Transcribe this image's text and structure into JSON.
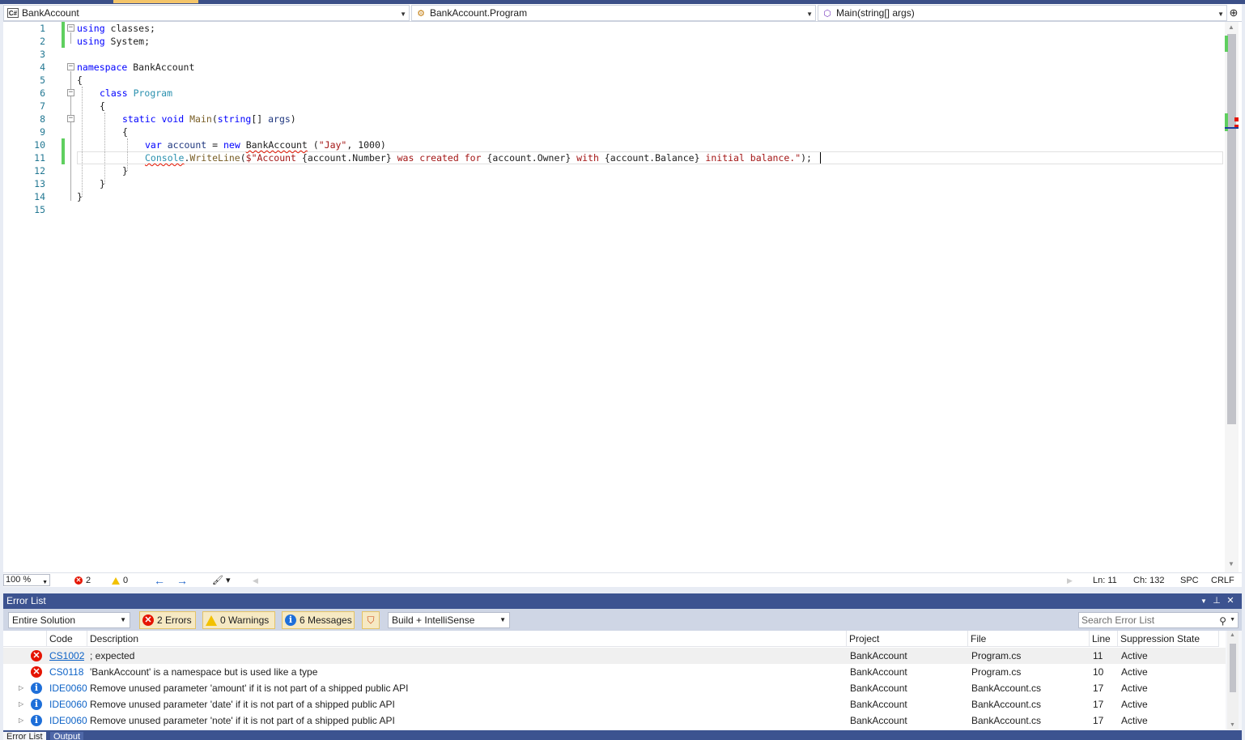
{
  "nav": {
    "project": "BankAccount",
    "project_icon": "C#",
    "type": "BankAccount.Program",
    "member": "Main(string[] args)"
  },
  "editor": {
    "line_numbers": [
      "1",
      "2",
      "3",
      "4",
      "5",
      "6",
      "7",
      "8",
      "9",
      "10",
      "11",
      "12",
      "13",
      "14",
      "15"
    ],
    "code": {
      "l1_kw": "using",
      "l1_rest": " classes;",
      "l2_kw": "using",
      "l2_rest": " System;",
      "l4_kw": "namespace",
      "l4_rest": " BankAccount",
      "l5": "{",
      "l6_kw": "class",
      "l6_ty": "Program",
      "l7": "{",
      "l8_kw1": "static",
      "l8_kw2": "void",
      "l8_me": "Main",
      "l8_p1": "(",
      "l8_kw3": "string",
      "l8_p2": "[] ",
      "l8_pa": "args",
      "l8_p3": ")",
      "l9": "{",
      "l10_kw1": "var",
      "l10_pa": "account",
      "l10_eq": " = ",
      "l10_kw2": "new",
      "l10_ty": "BankAccount",
      "l10_p1": " (",
      "l10_st": "\"Jay\"",
      "l10_p2": ", 1000)",
      "l11_ty": "Console",
      "l11_dot": ".",
      "l11_me": "WriteLine",
      "l11_p1": "(",
      "l11_s1": "$\"Account ",
      "l11_i1": "{account.Number}",
      "l11_s2": " was created for ",
      "l11_i2": "{account.Owner}",
      "l11_s3": " with ",
      "l11_i3": "{account.Balance}",
      "l11_s4": " initial balance.\"",
      "l11_p2": ");",
      "l12": "}",
      "l13": "}",
      "l14": "}"
    }
  },
  "status": {
    "zoom": "100 %",
    "errors": "2",
    "warnings": "0",
    "ln": "Ln: 11",
    "ch": "Ch: 132",
    "spc": "SPC",
    "crlf": "CRLF"
  },
  "error_list": {
    "title": "Error List",
    "scope": "Entire Solution",
    "errors_btn": "2 Errors",
    "warnings_btn": "0 Warnings",
    "messages_btn": "6 Messages",
    "build_filter": "Build + IntelliSense",
    "search_placeholder": "Search Error List",
    "columns": {
      "code": "Code",
      "description": "Description",
      "project": "Project",
      "file": "File",
      "line": "Line",
      "suppression": "Suppression State"
    },
    "rows": [
      {
        "code": "CS1002",
        "description": "; expected",
        "project": "BankAccount",
        "file": "Program.cs",
        "line": "11",
        "state": "Active"
      },
      {
        "code": "CS0118",
        "description": "'BankAccount' is a namespace but is used like a type",
        "project": "BankAccount",
        "file": "Program.cs",
        "line": "10",
        "state": "Active"
      },
      {
        "code": "IDE0060",
        "description": "Remove unused parameter 'amount' if it is not part of a shipped public API",
        "project": "BankAccount",
        "file": "BankAccount.cs",
        "line": "17",
        "state": "Active"
      },
      {
        "code": "IDE0060",
        "description": "Remove unused parameter 'date' if it is not part of a shipped public API",
        "project": "BankAccount",
        "file": "BankAccount.cs",
        "line": "17",
        "state": "Active"
      },
      {
        "code": "IDE0060",
        "description": "Remove unused parameter 'note' if it is not part of a shipped public API",
        "project": "BankAccount",
        "file": "BankAccount.cs",
        "line": "17",
        "state": "Active"
      }
    ],
    "tabs": {
      "errors": "Error List",
      "output": "Output"
    }
  },
  "colors": {
    "keyword": "#0000ff",
    "type": "#2b91af",
    "string": "#a31515",
    "error": "#e51400",
    "info": "#1e6fd9",
    "titlebar": "#3c5390"
  },
  "icons": {
    "error": "error-circle-icon",
    "warning": "warning-triangle-icon",
    "info": "info-circle-icon"
  }
}
